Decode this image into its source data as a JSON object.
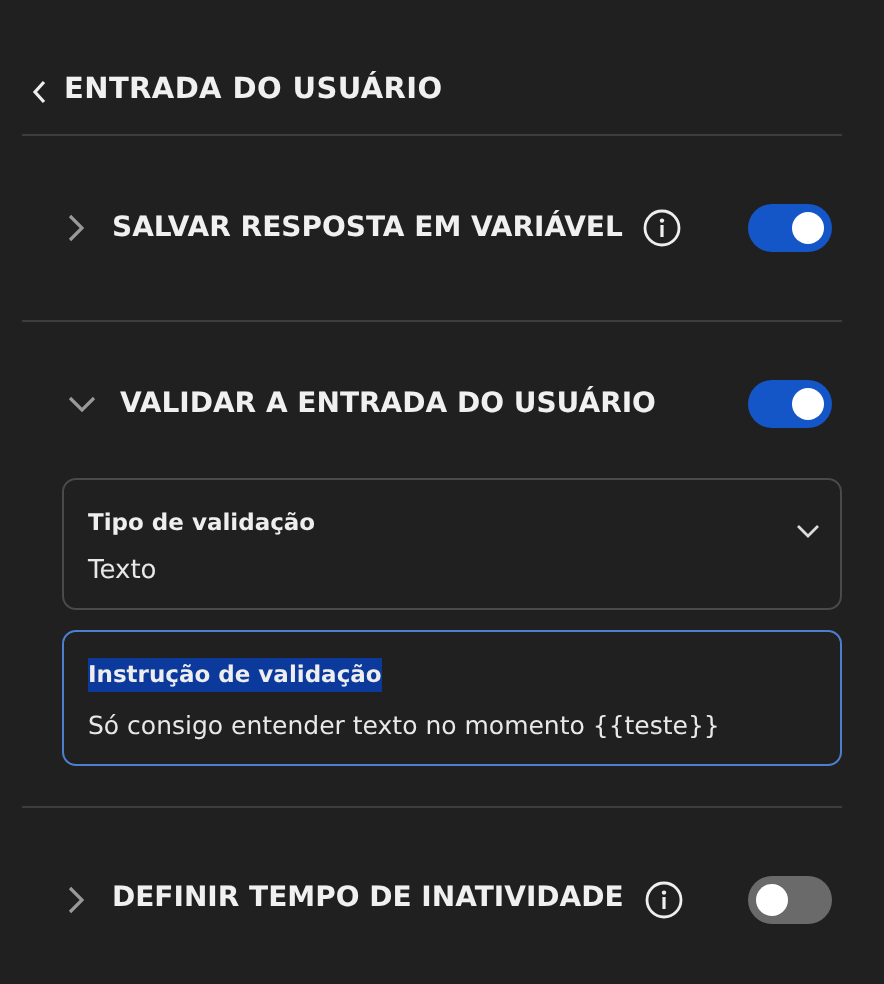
{
  "header": {
    "title": "ENTRADA DO USUÁRIO"
  },
  "sections": [
    {
      "title": "SALVAR RESPOSTA EM VARIÁVEL",
      "expanded": false,
      "info": true,
      "on": true
    },
    {
      "title": "VALIDAR A ENTRADA DO USUÁRIO",
      "expanded": true,
      "on": true,
      "fields": [
        {
          "kind": "select",
          "label": "Tipo de validação",
          "value": "Texto",
          "focused": false,
          "label_highlighted": false
        },
        {
          "kind": "text",
          "label": "Instrução de validação",
          "value": "Só consigo entender texto no momento {{teste}}",
          "focused": true,
          "label_highlighted": true
        }
      ]
    },
    {
      "title": "DEFINIR TEMPO DE INATIVIDADE",
      "expanded": false,
      "info": true,
      "on": false
    }
  ]
}
